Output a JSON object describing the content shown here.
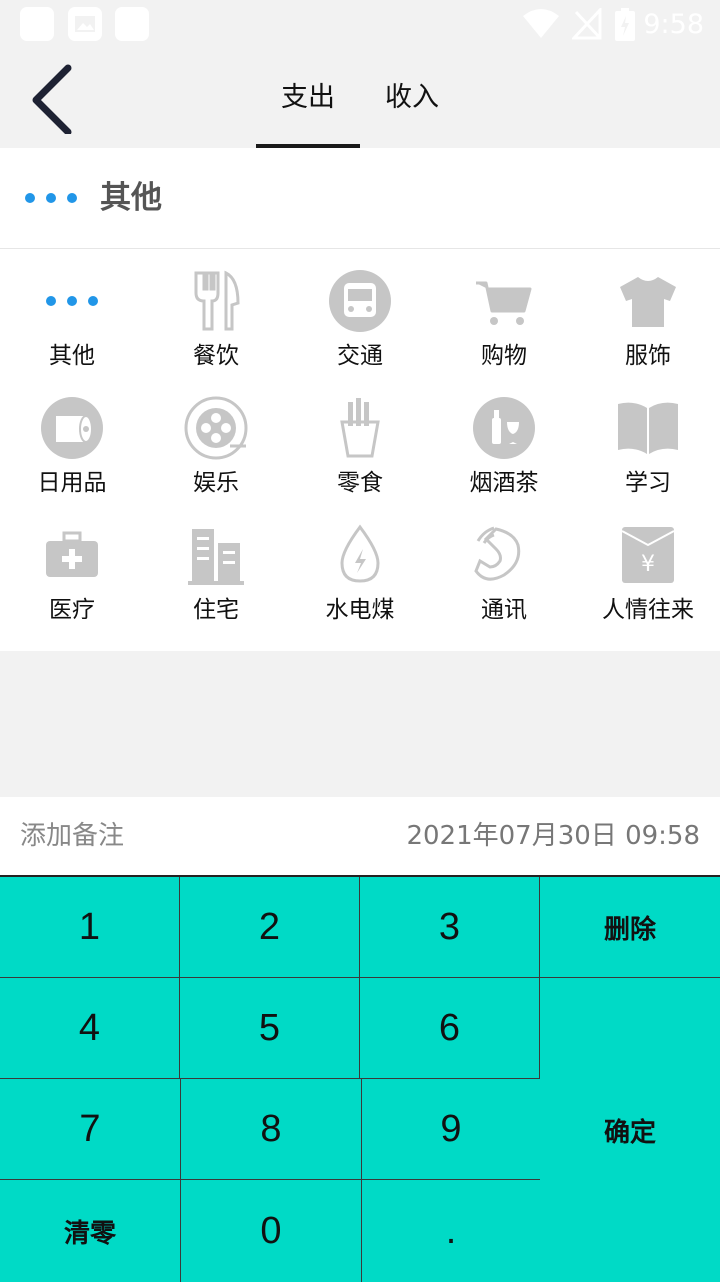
{
  "status_bar": {
    "time": "9:58"
  },
  "header": {
    "tabs": [
      {
        "label": "支出",
        "active": true
      },
      {
        "label": "收入",
        "active": false
      }
    ]
  },
  "selected_category": {
    "label": "其他",
    "icon": "more-dots-icon"
  },
  "categories": [
    {
      "label": "其他",
      "icon": "more-dots-icon"
    },
    {
      "label": "餐饮",
      "icon": "fork-knife-icon"
    },
    {
      "label": "交通",
      "icon": "bus-icon"
    },
    {
      "label": "购物",
      "icon": "shopping-cart-icon"
    },
    {
      "label": "服饰",
      "icon": "tshirt-icon"
    },
    {
      "label": "日用品",
      "icon": "tissue-roll-icon"
    },
    {
      "label": "娱乐",
      "icon": "film-reel-icon"
    },
    {
      "label": "零食",
      "icon": "fries-icon"
    },
    {
      "label": "烟酒茶",
      "icon": "wine-icon"
    },
    {
      "label": "学习",
      "icon": "book-icon"
    },
    {
      "label": "医疗",
      "icon": "medical-kit-icon"
    },
    {
      "label": "住宅",
      "icon": "building-icon"
    },
    {
      "label": "水电煤",
      "icon": "water-drop-icon"
    },
    {
      "label": "通讯",
      "icon": "phone-icon"
    },
    {
      "label": "人情往来",
      "icon": "red-envelope-icon"
    }
  ],
  "note": {
    "placeholder": "添加备注",
    "value": ""
  },
  "datetime": "2021年07月30日 09:58",
  "keypad": {
    "k1": "1",
    "k2": "2",
    "k3": "3",
    "delete": "删除",
    "k4": "4",
    "k5": "5",
    "k6": "6",
    "confirm": "确定",
    "k7": "7",
    "k8": "8",
    "k9": "9",
    "clear": "清零",
    "k0": "0",
    "dot": "."
  },
  "colors": {
    "accent": "#00dac6",
    "selected_dots": "#2196e8",
    "icon_gray": "#c6c6c6"
  }
}
